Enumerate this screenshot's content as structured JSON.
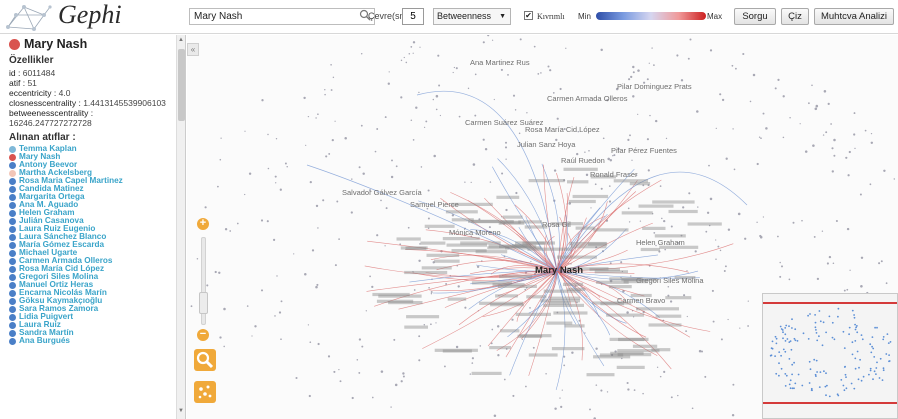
{
  "app": {
    "name": "Gephi"
  },
  "toolbar": {
    "search_value": "Mary Nash",
    "depth_label": "Çevre(sn)",
    "depth_value": "5",
    "metric_selected": "Betweenness",
    "curved_label": "Kıvrımlı",
    "curved_checked": true,
    "gradient_min": "Min",
    "gradient_max": "Max",
    "query_button": "Sorgu",
    "draw_button": "Çiz",
    "content_analysis_button": "Muhtcva Analizi"
  },
  "sidebar": {
    "node_name": "Mary Nash",
    "properties_heading": "Özellikler",
    "properties": [
      {
        "key": "id",
        "value": "6011484"
      },
      {
        "key": "atif",
        "value": "51"
      },
      {
        "key": "eccentricity",
        "value": "4.0"
      },
      {
        "key": "closnesscentrality",
        "value": "1.4413145539906103"
      },
      {
        "key": "betweenesscentrality",
        "value": "16246.247727272728"
      }
    ],
    "references_heading": "Alınan atıflar :",
    "references": [
      {
        "name": "Temma Kaplan",
        "color": "#7fb8d8"
      },
      {
        "name": "Mary Nash",
        "color": "#d9534f"
      },
      {
        "name": "Antony Beevor",
        "color": "#4a7fc7"
      },
      {
        "name": "Martha Ackelsberg",
        "color": "#f2c6b8"
      },
      {
        "name": "Rosa Maria Capel Martinez",
        "color": "#4a7fc7"
      },
      {
        "name": "Candida Matinez",
        "color": "#4a7fc7"
      },
      {
        "name": "Margarita Ortega",
        "color": "#4a7fc7"
      },
      {
        "name": "Ana M. Aguado",
        "color": "#4a7fc7"
      },
      {
        "name": "Helen Graham",
        "color": "#4a7fc7"
      },
      {
        "name": "Julián Casanova",
        "color": "#4a7fc7"
      },
      {
        "name": "Laura Ruiz Eugenio",
        "color": "#4a7fc7"
      },
      {
        "name": "Laura Sánchez Blanco",
        "color": "#4a7fc7"
      },
      {
        "name": "María Gómez Escarda",
        "color": "#4a7fc7"
      },
      {
        "name": "Michael Ugarte",
        "color": "#4a7fc7"
      },
      {
        "name": "Carmen Armada Olleros",
        "color": "#4a7fc7"
      },
      {
        "name": "Rosa María Cid López",
        "color": "#4a7fc7"
      },
      {
        "name": "Gregori Siles Molina",
        "color": "#4a7fc7"
      },
      {
        "name": "Manuel Ortiz Heras",
        "color": "#4a7fc7"
      },
      {
        "name": "Encarna Nicolás Marín",
        "color": "#4a7fc7"
      },
      {
        "name": "Göksu Kaymakçıoğlu",
        "color": "#4a7fc7"
      },
      {
        "name": "Sara Ramos Zamora",
        "color": "#4a7fc7"
      },
      {
        "name": "Lidia Puigvert",
        "color": "#4a7fc7"
      },
      {
        "name": "Laura Ruiz",
        "color": "#4a7fc7"
      },
      {
        "name": "Sandra Martín",
        "color": "#4a7fc7"
      },
      {
        "name": "Ana Burgués",
        "color": "#4a7fc7"
      }
    ]
  },
  "graph": {
    "center_label": "Mary Nash",
    "edge_colors": {
      "in": "#d96a6a",
      "out": "#6a8fd0"
    },
    "labels": [
      "Ana Martinez Rus",
      "Pilar Dominguez Prats",
      "Carmen Armada Olleros",
      "Carmen Suárez Suárez",
      "Rosa María Cid López",
      "Julian Sanz Hoya",
      "Raúl Ruedon",
      "Salvador Gálvez García",
      "Samuel Pierce",
      "Mónica Moreno",
      "Pilar Pérez Fuentes",
      "Rosa Gil",
      "Ronald Fraser",
      "Helen Graham",
      "Gregori Siles Molina",
      "Carmen Bravo"
    ]
  }
}
